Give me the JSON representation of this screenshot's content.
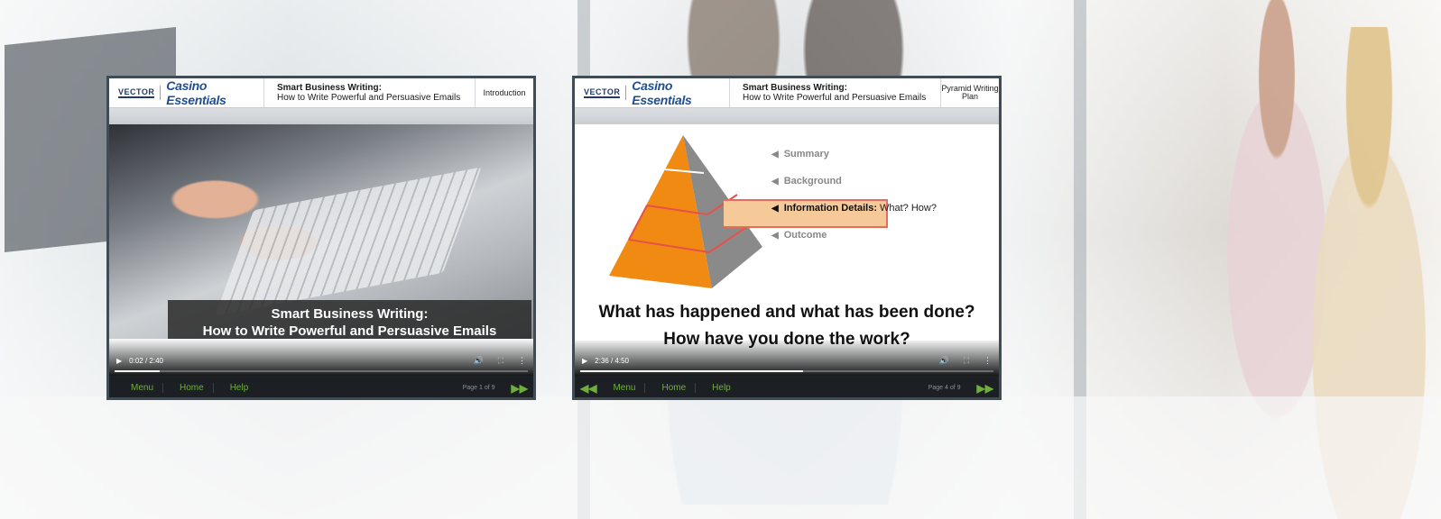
{
  "colors": {
    "frame": "#3f4b55",
    "brand": "#1f4f8e",
    "nav_green": "#6fae3a",
    "highlight": "#f6c998"
  },
  "players": [
    {
      "logo_vector": "VECTOR",
      "brand": "Casino Essentials",
      "course_title": "Smart Business Writing:",
      "course_subtitle": "How to Write Powerful and Persuasive Emails",
      "section": "Introduction",
      "caption_line1": "Smart Business Writing:",
      "caption_line2": "How to Write Powerful and Persuasive Emails",
      "time": "0:02 / 2:40",
      "progress": 0.11,
      "nav": [
        "Menu",
        "Home",
        "Help"
      ],
      "page": "Page 1 of 9"
    },
    {
      "logo_vector": "VECTOR",
      "brand": "Casino Essentials",
      "course_title": "Smart Business Writing:",
      "course_subtitle": "How to Write Powerful and Persuasive Emails",
      "section": "Pyramid Writing Plan",
      "pyramid_items": [
        {
          "label": "Summary"
        },
        {
          "label": "Background"
        },
        {
          "label": "Information Details:",
          "suffix": "What? How?"
        },
        {
          "label": "Outcome"
        }
      ],
      "question1": "What has happened and what has been done?",
      "question2": "How have you done the work?",
      "time": "2:36 / 4:50",
      "progress": 0.54,
      "nav": [
        "Menu",
        "Home",
        "Help"
      ],
      "page": "Page 4 of 9"
    }
  ]
}
